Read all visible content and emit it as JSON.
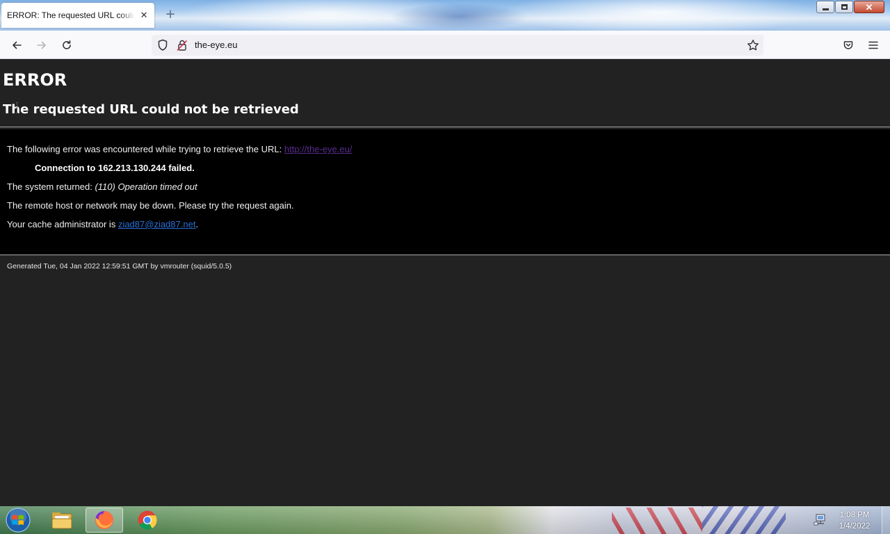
{
  "browser": {
    "tab": {
      "title": "ERROR: The requested URL could not be retrieved",
      "close_glyph": "✕"
    },
    "new_tab_glyph": "+",
    "url": "the-eye.eu",
    "icons": {
      "back": "arrow-left-icon",
      "forward": "arrow-right-icon",
      "reload": "reload-icon",
      "tracking": "shield-icon",
      "security": "broken-lock-icon",
      "bookmark": "star-icon",
      "pocket": "pocket-icon",
      "menu": "hamburger-menu-icon"
    },
    "window_controls": {
      "close_glyph": "✕"
    }
  },
  "page": {
    "heading": "ERROR",
    "subheading": "The requested URL could not be retrieved",
    "error_intro": "The following error was encountered while trying to retrieve the URL: ",
    "error_url": "http://the-eye.eu/",
    "connection_failed": "Connection to 162.213.130.244 failed.",
    "system_returned_label": "The system returned: ",
    "system_returned_value": "(110) Operation timed out",
    "remote_host_msg": "The remote host or network may be down. Please try the request again.",
    "cache_admin_label": "Your cache administrator is ",
    "cache_admin_email": "ziad87@ziad87.net",
    "cache_admin_suffix": ".",
    "footer": "Generated Tue, 04 Jan 2022 12:59:51 GMT by vmrouter (squid/5.0.5)",
    "colors": {
      "background": "#222222",
      "content_box": "#000000",
      "visited_link": "#5a2b90",
      "link": "#2a6fd8"
    }
  },
  "taskbar": {
    "pinned": [
      "file-explorer-icon",
      "firefox-icon",
      "chrome-icon"
    ],
    "active": "firefox-icon",
    "clock": {
      "time": "1:08 PM",
      "date": "1/4/2022"
    }
  }
}
